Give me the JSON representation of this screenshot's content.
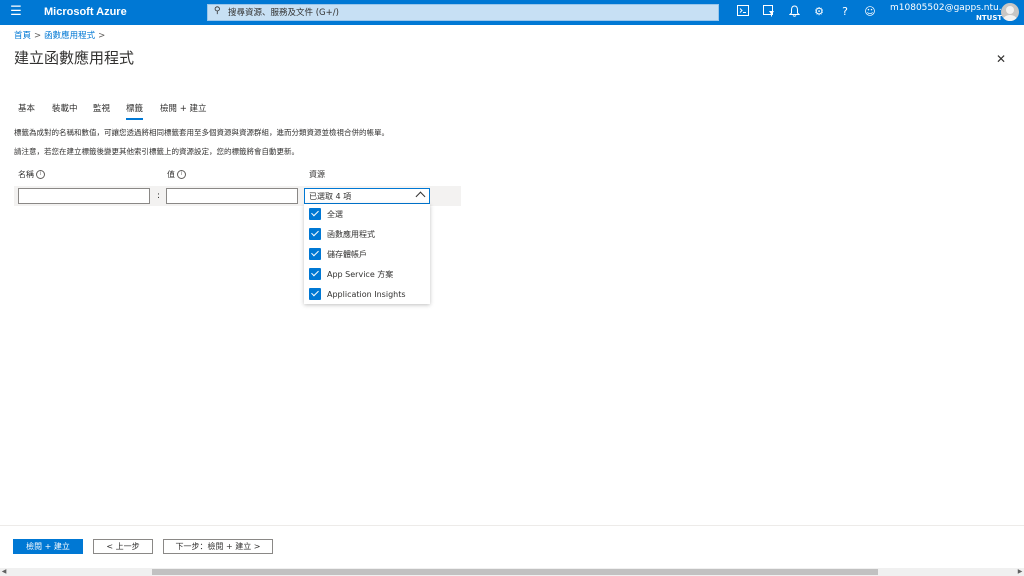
{
  "topbar": {
    "brand": "Microsoft Azure",
    "search_placeholder": "搜尋資源、服務及文件 (G+/)",
    "account_email": "m10805502@gapps.ntu...",
    "account_org": "NTUST"
  },
  "breadcrumb": {
    "home": "首頁",
    "current": "函數應用程式",
    "sep": ">"
  },
  "page_title": "建立函數應用程式",
  "tabs": [
    {
      "label": "基本"
    },
    {
      "label": "裝載中"
    },
    {
      "label": "監視"
    },
    {
      "label": "標籤"
    },
    {
      "label": "檢閱 + 建立"
    }
  ],
  "description": {
    "line1": "標籤為成對的名稱和數值，可讓您透過將相同標籤套用至多個資源與資源群組，進而分類資源並檢視合併的帳單。",
    "line2": "請注意，若您在建立標籤後變更其他索引標籤上的資源設定，您的標籤將會自動更新。"
  },
  "tag_grid": {
    "name_header": "名稱",
    "value_header": "值",
    "resource_header": "資源",
    "name_value": "",
    "value_value": "",
    "separator": ":",
    "resource_selected": "已選取 4 項",
    "options": [
      {
        "label": "全選",
        "checked": true
      },
      {
        "label": "函數應用程式",
        "checked": true
      },
      {
        "label": "儲存體帳戶",
        "checked": true
      },
      {
        "label": "App Service 方案",
        "checked": true
      },
      {
        "label": "Application Insights",
        "checked": true
      }
    ]
  },
  "footer": {
    "review_create": "檢閱 + 建立",
    "previous": "< 上一步",
    "next": "下一步：檢閱 + 建立 >"
  },
  "colors": {
    "accent": "#0078d4",
    "topbar": "#0078d4"
  },
  "icons": [
    "hamburger-icon",
    "search-icon",
    "cloud-shell-icon",
    "directory-filter-icon",
    "bell-icon",
    "gear-icon",
    "help-icon",
    "feedback-icon",
    "close-icon",
    "info-icon",
    "chevron-up-icon",
    "checkbox-checked-icon"
  ]
}
